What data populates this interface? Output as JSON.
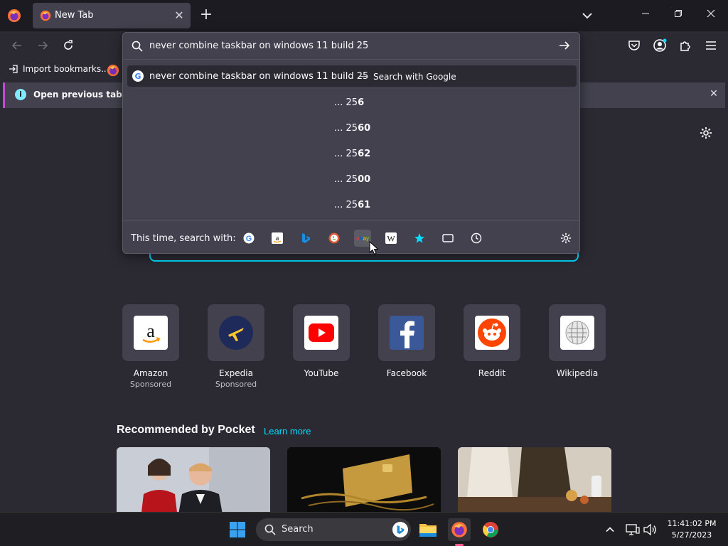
{
  "browser": {
    "tab": {
      "title": "New Tab"
    },
    "url_input": {
      "value": "never combine taskbar on windows 11 build 25"
    },
    "bookmarks": [
      {
        "label": "Import bookmarks..."
      }
    ],
    "notification": {
      "message": "Open previous tabs? You"
    }
  },
  "dropdown": {
    "top_result": {
      "query": "never combine taskbar on windows 11 build 25",
      "separator": "—",
      "hint": "Search with Google"
    },
    "suggestions": [
      {
        "prefix": "... 25",
        "suffix": "6"
      },
      {
        "prefix": "... 25",
        "suffix": "60"
      },
      {
        "prefix": "... 25",
        "suffix": "62"
      },
      {
        "prefix": "... 25",
        "suffix": "00"
      },
      {
        "prefix": "... 25",
        "suffix": "61"
      }
    ],
    "one_off": {
      "label": "This time, search with:",
      "engines": [
        "google-icon",
        "amazon-icon",
        "bing-icon",
        "duckduckgo-icon",
        "ebay-icon",
        "wikipedia-icon",
        "bookmarks-star-icon",
        "tabs-icon",
        "history-icon"
      ],
      "selected": "ebay-icon"
    }
  },
  "top_sites": [
    {
      "name": "Amazon",
      "sponsored": "Sponsored",
      "icon": "amazon-icon"
    },
    {
      "name": "Expedia",
      "sponsored": "Sponsored",
      "icon": "expedia-icon"
    },
    {
      "name": "YouTube",
      "sponsored": "",
      "icon": "youtube-icon"
    },
    {
      "name": "Facebook",
      "sponsored": "",
      "icon": "facebook-icon"
    },
    {
      "name": "Reddit",
      "sponsored": "",
      "icon": "reddit-icon"
    },
    {
      "name": "Wikipedia",
      "sponsored": "",
      "icon": "wikipedia-icon"
    }
  ],
  "pocket": {
    "title": "Recommended by Pocket",
    "learn_more": "Learn more",
    "cards": [
      {
        "image": "people-photo"
      },
      {
        "image": "gold-card-photo"
      },
      {
        "image": "cooking-photo"
      }
    ]
  },
  "taskbar": {
    "search_label": "Search",
    "time": "11:41:02 PM",
    "date": "5/27/2023"
  },
  "colors": {
    "accent": "#00ddff",
    "notification_stripe": "#c04cd3",
    "background": "#2b2a33",
    "panel": "#42414d"
  }
}
